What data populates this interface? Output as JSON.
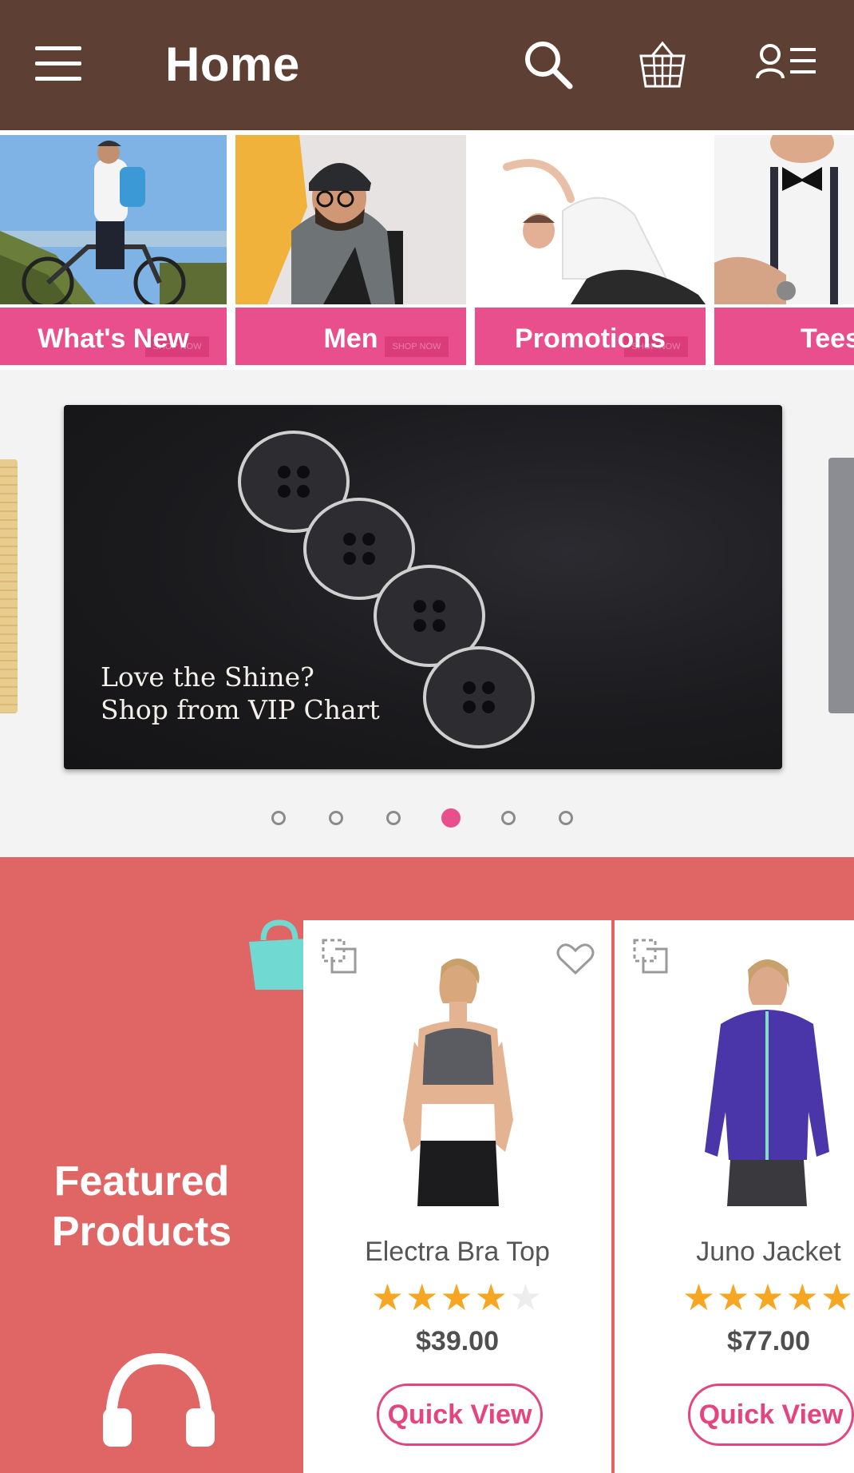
{
  "appbar": {
    "title": "Home",
    "icons": [
      "menu-icon",
      "search-icon",
      "basket-icon",
      "account-menu-icon"
    ],
    "background": "#5d3f33"
  },
  "categories": [
    {
      "label": "What's New",
      "shop_now": "SHOP NOW"
    },
    {
      "label": "Men",
      "shop_now": "SHOP NOW"
    },
    {
      "label": "Promotions",
      "shop_now": "SHOP NOW"
    },
    {
      "label": "Tees",
      "shop_now": ""
    }
  ],
  "banner": {
    "caption": "Love the Shine? Shop from VIP Chart",
    "slides_count": 6,
    "active_slide": 4
  },
  "featured": {
    "heading": "Featured Products",
    "products": [
      {
        "name": "Electra Bra Top",
        "rating": 4,
        "price": "$39.00",
        "action": "Quick View"
      },
      {
        "name": "Juno Jacket",
        "rating": 4.5,
        "price": "$77.00",
        "action": "Quick View"
      }
    ]
  },
  "colors": {
    "accent": "#e94f8d",
    "featured_bg": "#e06565",
    "star": "#f6a623"
  }
}
